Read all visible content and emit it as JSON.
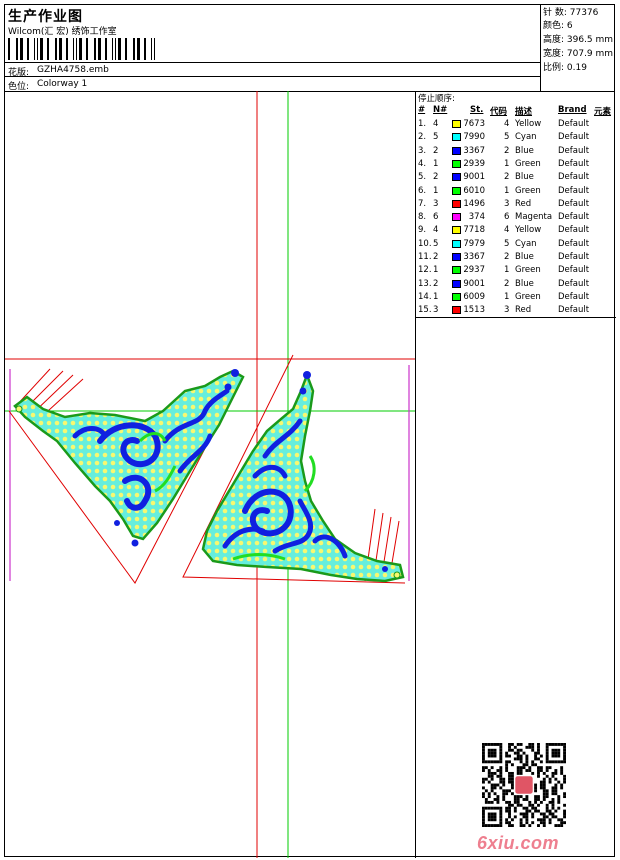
{
  "header": {
    "title": "生产作业图",
    "company": "Wilcom(汇 宏) 绣饰工作室",
    "design_label": "花版:",
    "design_value": "GZHA4758.emb",
    "colorway_label": "色位:",
    "colorway_value": "Colorway 1"
  },
  "stats": {
    "stitches": "针 数: 77376",
    "colors": "颜色: 6",
    "height": "高度: 396.5 mm",
    "width": "宽度: 707.9 mm",
    "scale": "比例: 0.19"
  },
  "stop_sequence": {
    "title": "停止顺序:",
    "headers": [
      "#",
      "N#",
      "St.",
      "代码",
      "描述",
      "Brand",
      "元素"
    ],
    "rows": [
      {
        "num": "1.",
        "n": "4",
        "st": "7673",
        "code": "4",
        "desc": "Yellow",
        "brand": "Default",
        "color": "#ffff00"
      },
      {
        "num": "2.",
        "n": "5",
        "st": "7990",
        "code": "5",
        "desc": "Cyan",
        "brand": "Default",
        "color": "#00ffff"
      },
      {
        "num": "3.",
        "n": "2",
        "st": "3367",
        "code": "2",
        "desc": "Blue",
        "brand": "Default",
        "color": "#0000ff"
      },
      {
        "num": "4.",
        "n": "1",
        "st": "2939",
        "code": "1",
        "desc": "Green",
        "brand": "Default",
        "color": "#00ff00"
      },
      {
        "num": "5.",
        "n": "2",
        "st": "9001",
        "code": "2",
        "desc": "Blue",
        "brand": "Default",
        "color": "#0000ff"
      },
      {
        "num": "6.",
        "n": "1",
        "st": "6010",
        "code": "1",
        "desc": "Green",
        "brand": "Default",
        "color": "#00ff00"
      },
      {
        "num": "7.",
        "n": "3",
        "st": "1496",
        "code": "3",
        "desc": "Red",
        "brand": "Default",
        "color": "#ff0000"
      },
      {
        "num": "8.",
        "n": "6",
        "st": "374",
        "code": "6",
        "desc": "Magenta",
        "brand": "Default",
        "color": "#ff00ff"
      },
      {
        "num": "9.",
        "n": "4",
        "st": "7718",
        "code": "4",
        "desc": "Yellow",
        "brand": "Default",
        "color": "#ffff00"
      },
      {
        "num": "10.",
        "n": "5",
        "st": "7979",
        "code": "5",
        "desc": "Cyan",
        "brand": "Default",
        "color": "#00ffff"
      },
      {
        "num": "11.",
        "n": "2",
        "st": "3367",
        "code": "2",
        "desc": "Blue",
        "brand": "Default",
        "color": "#0000ff"
      },
      {
        "num": "12.",
        "n": "1",
        "st": "2937",
        "code": "1",
        "desc": "Green",
        "brand": "Default",
        "color": "#00ff00"
      },
      {
        "num": "13.",
        "n": "2",
        "st": "9001",
        "code": "2",
        "desc": "Blue",
        "brand": "Default",
        "color": "#0000ff"
      },
      {
        "num": "14.",
        "n": "1",
        "st": "6009",
        "code": "1",
        "desc": "Green",
        "brand": "Default",
        "color": "#00ff00"
      },
      {
        "num": "15.",
        "n": "3",
        "st": "1513",
        "code": "3",
        "desc": "Red",
        "brand": "Default",
        "color": "#ff0000"
      }
    ]
  },
  "watermark": "6xiu.com",
  "colors": {
    "guide_red": "#e00000",
    "guide_green": "#00cc00",
    "frame_magenta": "#cc33cc",
    "fill_cyan": "#66eedd",
    "fill_yellow": "#f8f870",
    "thread_blue": "#1020e0",
    "thread_green": "#22dd22"
  }
}
